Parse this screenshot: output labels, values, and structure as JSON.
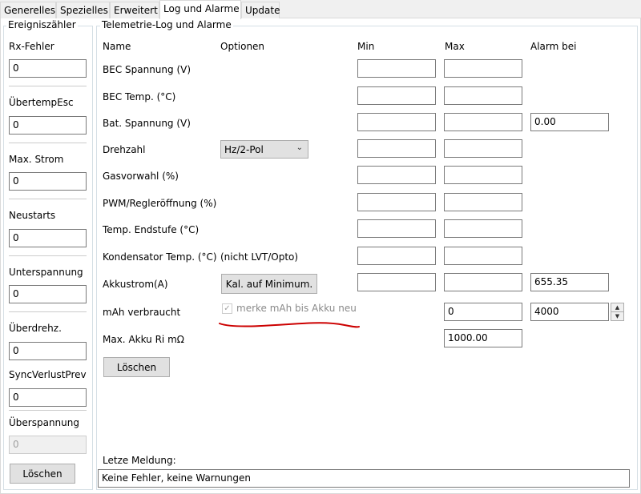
{
  "tabs": [
    "Generelles",
    "Spezielles",
    "Erweitert",
    "Log und Alarme",
    "Update"
  ],
  "event_counter": {
    "title": "Ereigniszähler",
    "items": [
      {
        "label": "Rx-Fehler",
        "value": "0"
      },
      {
        "label": "ÜbertempEsc",
        "value": "0"
      },
      {
        "label": "Max. Strom",
        "value": "0"
      },
      {
        "label": "Neustarts",
        "value": "0"
      },
      {
        "label": "Unterspannung",
        "value": "0"
      },
      {
        "label": "Überdrehz.",
        "value": "0"
      },
      {
        "label": "SyncVerlustPrev",
        "value": "0"
      },
      {
        "label": "Überspannung",
        "value": "0"
      }
    ],
    "clear_label": "Löschen"
  },
  "telemetry": {
    "title": "Telemetrie-Log und Alarme",
    "headers": {
      "name": "Name",
      "options": "Optionen",
      "min": "Min",
      "max": "Max",
      "alarm": "Alarm bei"
    },
    "rows": [
      {
        "name": "BEC Spannung (V)",
        "min": "",
        "max": "",
        "alarm": ""
      },
      {
        "name": "BEC Temp. (°C)",
        "min": "",
        "max": "",
        "alarm": ""
      },
      {
        "name": "Bat. Spannung (V)",
        "min": "",
        "max": "",
        "alarm": "0.00"
      },
      {
        "name": "Drehzahl",
        "option": "Hz/2-Pol",
        "min": "",
        "max": "",
        "alarm": ""
      },
      {
        "name": "Gasvorwahl (%)",
        "min": "",
        "max": "",
        "alarm": ""
      },
      {
        "name": "PWM/Regleröffnung (%)",
        "min": "",
        "max": "",
        "alarm": ""
      },
      {
        "name": "Temp. Endstufe (°C)",
        "min": "",
        "max": "",
        "alarm": ""
      },
      {
        "name": "Kondensator Temp. (°C)",
        "option": "(nicht LVT/Opto)",
        "min": "",
        "max": "",
        "alarm": ""
      },
      {
        "name": "Akkustrom(A)",
        "option": "Kal. auf Minimum.",
        "min": "",
        "max": "",
        "alarm": "655.35"
      },
      {
        "name": "mAh verbraucht",
        "option": "merke mAh bis Akku neu",
        "checked": true,
        "max": "0",
        "alarm": "4000"
      },
      {
        "name": "Max. Akku Ri mΩ",
        "max": "1000.00"
      }
    ],
    "clear_label": "Löschen",
    "last_message_label": "Letze Meldung:",
    "last_message": "Keine Fehler, keine Warnungen"
  },
  "annotation_color": "#cc0000"
}
